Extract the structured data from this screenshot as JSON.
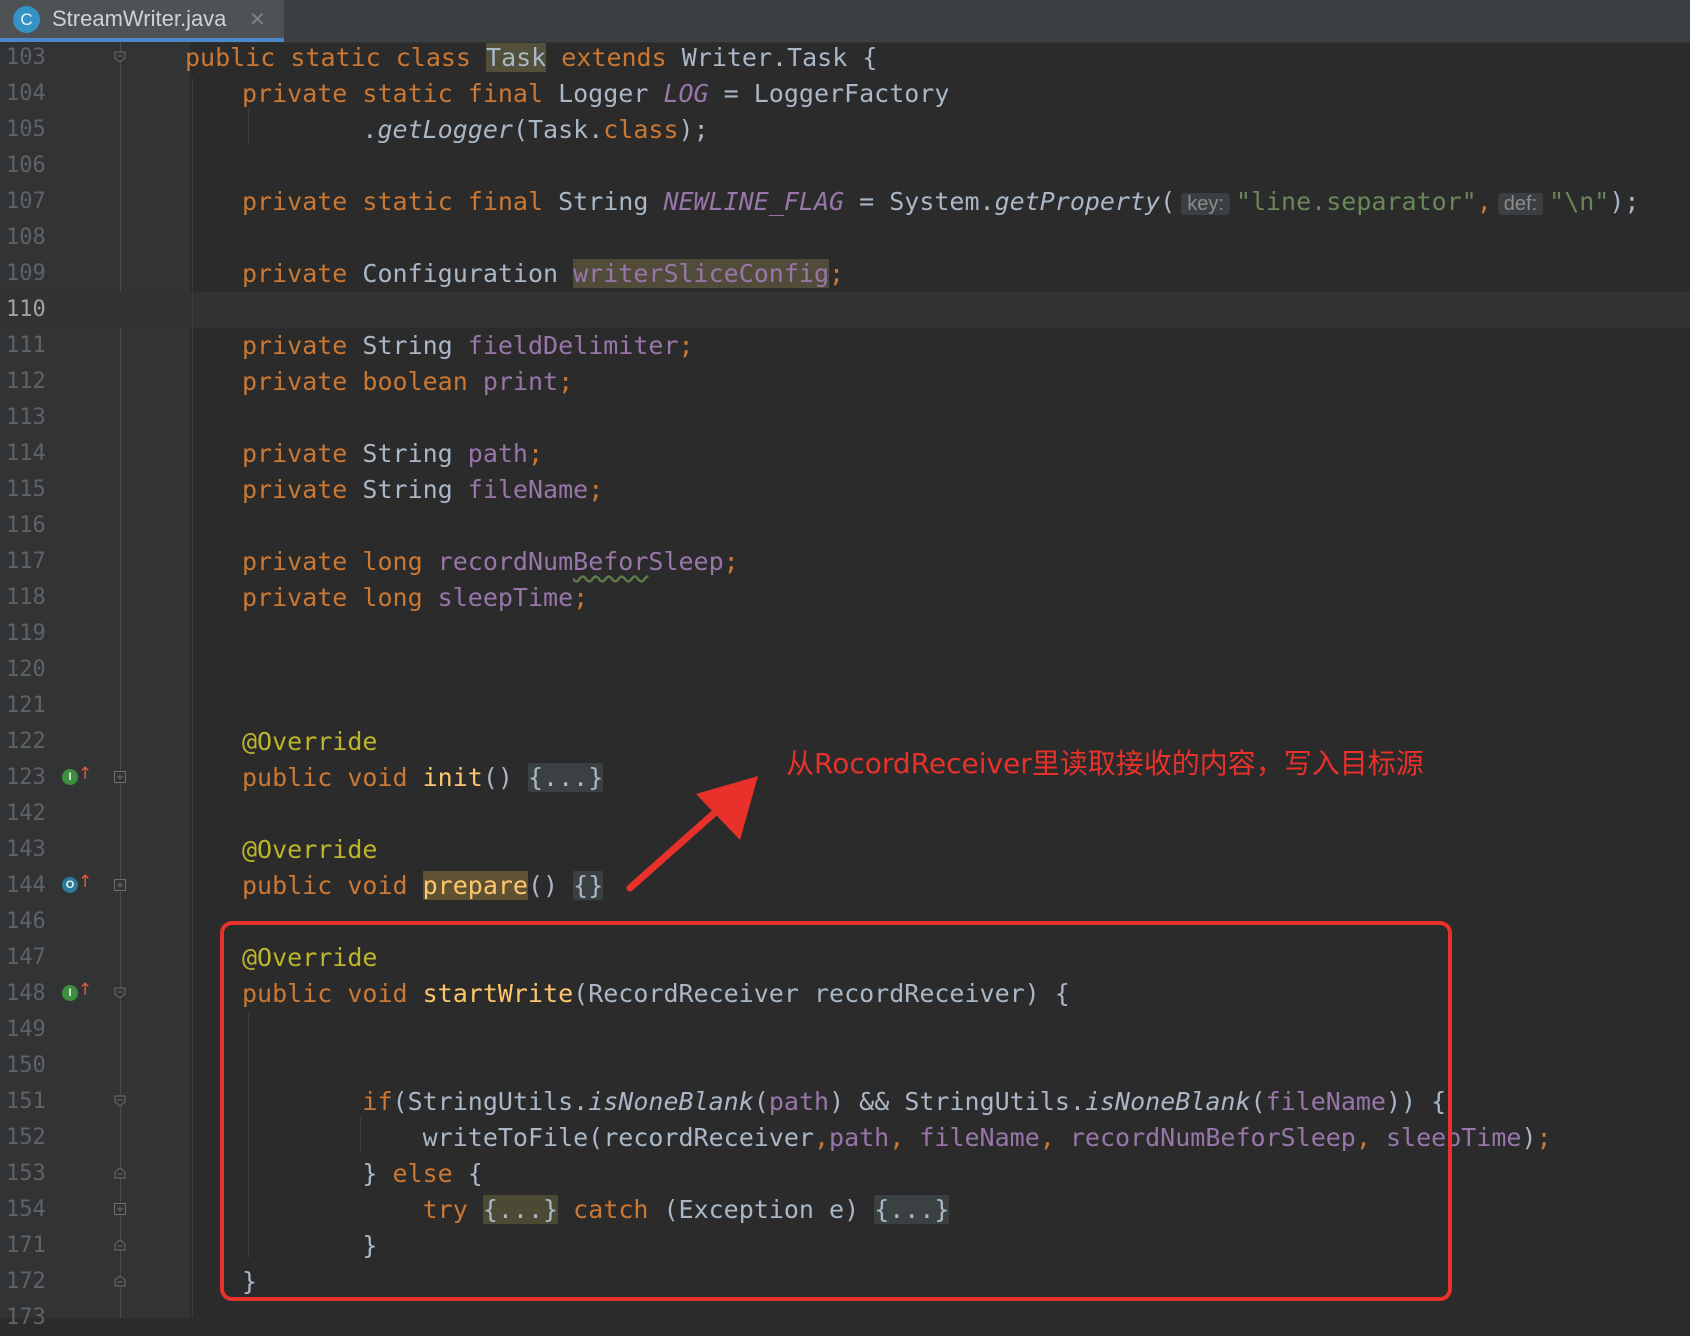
{
  "tab": {
    "icon_letter": "C",
    "title": "StreamWriter.java",
    "close_glyph": "✕"
  },
  "annotation": {
    "text": "从RocordReceiver里读取接收的内容，写入目标源",
    "color": "#e8312a"
  },
  "colors": {
    "background": "#2b2b2b",
    "gutter": "#313335",
    "keyword": "#cc7832",
    "field": "#9876aa",
    "method": "#ffc66d",
    "string": "#6a8759",
    "annotation": "#bbb529",
    "plain": "#a9b7c6",
    "callout": "#e8312a"
  },
  "lines": [
    {
      "num": "103",
      "fold": "start",
      "tokens": [
        [
          "kw",
          "public static class "
        ],
        [
          "hl",
          "Task"
        ],
        [
          "kw",
          " extends "
        ],
        [
          "",
          "Writer.Task {"
        ]
      ]
    },
    {
      "num": "104",
      "tokens": [
        [
          "kw",
          "private static final "
        ],
        [
          "",
          "Logger "
        ],
        [
          "st",
          "LOG"
        ],
        [
          "",
          " = LoggerFactory"
        ]
      ]
    },
    {
      "num": "105",
      "tokens": [
        [
          "",
          "        ."
        ],
        [
          "it",
          "getLogger"
        ],
        [
          "",
          "(Task."
        ],
        [
          "kw",
          "class"
        ],
        [
          "",
          ");"
        ]
      ]
    },
    {
      "num": "106",
      "tokens": []
    },
    {
      "num": "107",
      "tokens": [
        [
          "kw",
          "private static final "
        ],
        [
          "",
          "String "
        ],
        [
          "st",
          "NEWLINE_FLAG"
        ],
        [
          "",
          " = System."
        ],
        [
          "it",
          "getProperty"
        ],
        [
          "",
          "("
        ],
        [
          "hint",
          "key:"
        ],
        [
          "str",
          "\"line.separator\""
        ],
        [
          "kw",
          ","
        ],
        [
          "hint",
          "def:"
        ],
        [
          "str",
          "\"\\n\""
        ],
        [
          "",
          ");"
        ]
      ]
    },
    {
      "num": "108",
      "tokens": []
    },
    {
      "num": "109",
      "tokens": [
        [
          "kw",
          "private "
        ],
        [
          "",
          "Configuration "
        ],
        [
          "fdhl",
          "writerSliceConfig"
        ],
        [
          "kw",
          ";"
        ]
      ]
    },
    {
      "num": "110",
      "current": true,
      "tokens": []
    },
    {
      "num": "111",
      "tokens": [
        [
          "kw",
          "private "
        ],
        [
          "",
          "String "
        ],
        [
          "fd",
          "fieldDelimiter"
        ],
        [
          "kw",
          ";"
        ]
      ]
    },
    {
      "num": "112",
      "tokens": [
        [
          "kw",
          "private boolean "
        ],
        [
          "fd",
          "print"
        ],
        [
          "kw",
          ";"
        ]
      ]
    },
    {
      "num": "113",
      "tokens": []
    },
    {
      "num": "114",
      "tokens": [
        [
          "kw",
          "private "
        ],
        [
          "",
          "String "
        ],
        [
          "fd",
          "path"
        ],
        [
          "kw",
          ";"
        ]
      ]
    },
    {
      "num": "115",
      "tokens": [
        [
          "kw",
          "private "
        ],
        [
          "",
          "String "
        ],
        [
          "fd",
          "fileName"
        ],
        [
          "kw",
          ";"
        ]
      ]
    },
    {
      "num": "116",
      "tokens": []
    },
    {
      "num": "117",
      "tokens": [
        [
          "kw",
          "private long "
        ],
        [
          "fd",
          "recordNum"
        ],
        [
          "fdw",
          "Befor"
        ],
        [
          "fd",
          "Sleep"
        ],
        [
          "kw",
          ";"
        ]
      ]
    },
    {
      "num": "118",
      "tokens": [
        [
          "kw",
          "private long "
        ],
        [
          "fd",
          "sleepTime"
        ],
        [
          "kw",
          ";"
        ]
      ]
    },
    {
      "num": "119",
      "tokens": []
    },
    {
      "num": "120",
      "tokens": []
    },
    {
      "num": "121",
      "tokens": []
    },
    {
      "num": "122",
      "tokens": [
        [
          "an",
          "@Override"
        ]
      ]
    },
    {
      "num": "123",
      "marker": "implements",
      "fold": "collapsed",
      "tokens": [
        [
          "kw",
          "public void "
        ],
        [
          "sm",
          "init"
        ],
        [
          "",
          "() "
        ],
        [
          "fb",
          "{...}"
        ]
      ]
    },
    {
      "num": "142",
      "tokens": []
    },
    {
      "num": "143",
      "tokens": [
        [
          "an",
          "@Override"
        ]
      ]
    },
    {
      "num": "144",
      "marker": "override",
      "fold": "collapsed",
      "tokens": [
        [
          "kw",
          "public void "
        ],
        [
          "smhl",
          "prepare"
        ],
        [
          "",
          "() "
        ],
        [
          "fb",
          "{}"
        ]
      ]
    },
    {
      "num": "146",
      "tokens": []
    },
    {
      "num": "147",
      "tokens": [
        [
          "an",
          "@Override"
        ]
      ]
    },
    {
      "num": "148",
      "marker": "implements",
      "fold": "start",
      "tokens": [
        [
          "kw",
          "public void "
        ],
        [
          "sm",
          "startWrite"
        ],
        [
          "",
          "(RecordReceiver recordReceiver) {"
        ]
      ]
    },
    {
      "num": "149",
      "tokens": []
    },
    {
      "num": "150",
      "tokens": []
    },
    {
      "num": "151",
      "fold": "start",
      "tokens": [
        [
          "",
          "        "
        ],
        [
          "kw",
          "if"
        ],
        [
          "",
          "(StringUtils."
        ],
        [
          "it",
          "isNoneBlank"
        ],
        [
          "",
          "("
        ],
        [
          "fd",
          "path"
        ],
        [
          "",
          ") && StringUtils."
        ],
        [
          "it",
          "isNoneBlank"
        ],
        [
          "",
          "("
        ],
        [
          "fd",
          "fileName"
        ],
        [
          "",
          ")) {"
        ]
      ]
    },
    {
      "num": "152",
      "tokens": [
        [
          "",
          "            writeToFile(recordReceiver"
        ],
        [
          "kw",
          ","
        ],
        [
          "fd",
          "path"
        ],
        [
          "kw",
          ", "
        ],
        [
          "fd",
          "fileName"
        ],
        [
          "kw",
          ", "
        ],
        [
          "fd",
          "recordNumBeforSleep"
        ],
        [
          "kw",
          ", "
        ],
        [
          "fd",
          "sleepTime"
        ],
        [
          "",
          ")"
        ],
        [
          "kw",
          ";"
        ]
      ]
    },
    {
      "num": "153",
      "fold": "end",
      "tokens": [
        [
          "",
          "        } "
        ],
        [
          "kw",
          "else "
        ],
        [
          "",
          "{"
        ]
      ]
    },
    {
      "num": "154",
      "fold": "collapsed",
      "tokens": [
        [
          "",
          "            "
        ],
        [
          "kw",
          "try "
        ],
        [
          "fb3",
          "{...}"
        ],
        [
          "kw",
          " catch "
        ],
        [
          "",
          "(Exception e) "
        ],
        [
          "fb",
          "{...}"
        ]
      ]
    },
    {
      "num": "171",
      "fold": "end",
      "tokens": [
        [
          "",
          "        }"
        ]
      ]
    },
    {
      "num": "172",
      "fold": "end",
      "tokens": [
        [
          "",
          "}"
        ]
      ]
    },
    {
      "num": "173",
      "tokens": []
    }
  ]
}
